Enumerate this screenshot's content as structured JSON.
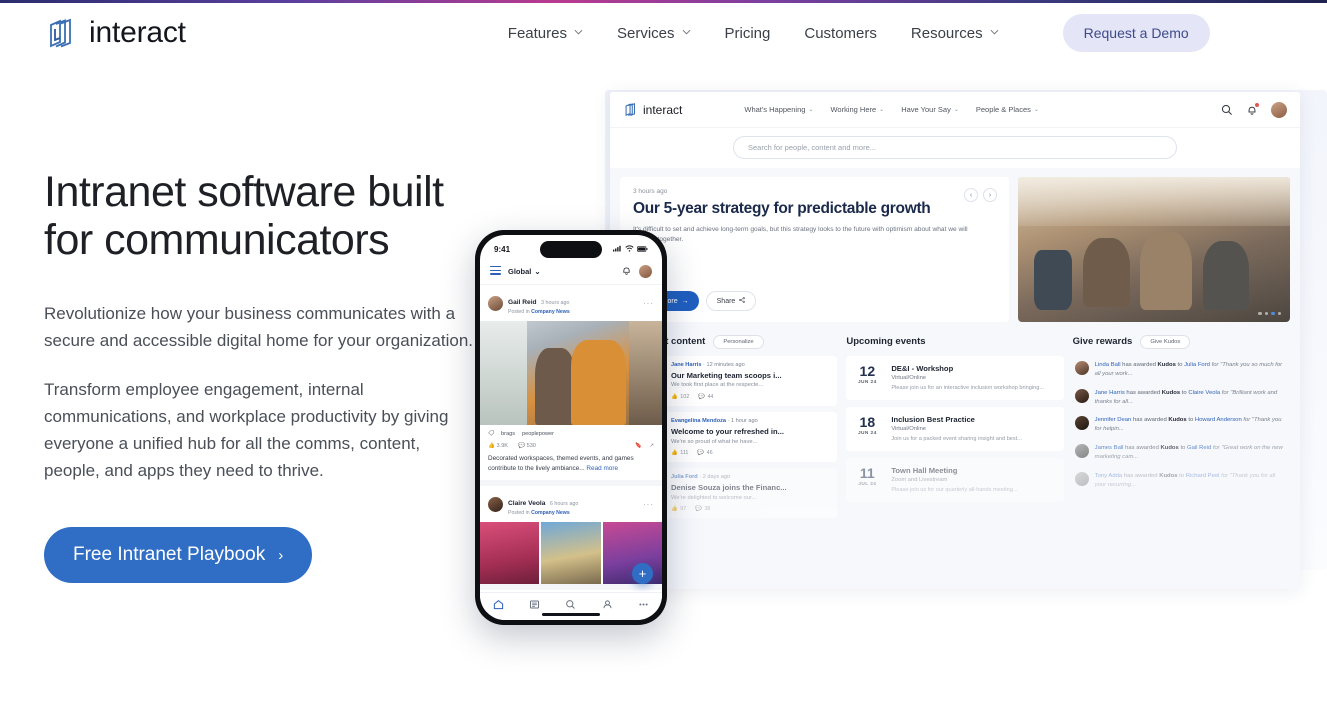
{
  "site": {
    "brand": "interact",
    "nav": [
      {
        "label": "Features",
        "caret": true
      },
      {
        "label": "Services",
        "caret": true
      },
      {
        "label": "Pricing",
        "caret": false
      },
      {
        "label": "Customers",
        "caret": false
      },
      {
        "label": "Resources",
        "caret": true
      }
    ],
    "demo_button": "Request a Demo",
    "accent_blue": "#2f6ec4",
    "demo_button_bg": "#e4e6f7"
  },
  "hero": {
    "title": "Intranet software built for communicators",
    "paragraph1": "Revolutionize how your business communicates with a secure and accessible digital home for your organization.",
    "paragraph2": "Transform employee engagement, internal communications, and workplace productivity by giving everyone a unified hub for all the comms, content, people, and apps they need to thrive.",
    "cta_label": "Free Intranet Playbook",
    "cta_chevron": "›"
  },
  "desktop_mock": {
    "brand": "interact",
    "nav": [
      {
        "label": "What's Happening",
        "caret": "⌄"
      },
      {
        "label": "Working Here",
        "caret": "⌄"
      },
      {
        "label": "Have Your Say",
        "caret": "⌄"
      },
      {
        "label": "People & Places",
        "caret": "⌄"
      }
    ],
    "search_placeholder": "Search for people, content and more...",
    "feature": {
      "timestamp": "3 hours ago",
      "title": "Our 5-year strategy for predictable growth",
      "description": "It's difficult to set and achieve long-term goals, but this strategy looks to the future with optimism about what we will achieve together.",
      "primary_button": "Read More",
      "primary_button_icon": "→",
      "secondary_button": "Share",
      "prev_icon": "‹",
      "next_icon": "›",
      "carousel_dots": 4,
      "carousel_active": 3
    },
    "columns": {
      "content": {
        "title": "Your latest content",
        "action": "Personalize",
        "items": [
          {
            "author": "Jane Harris",
            "time": "12 minutes ago",
            "title": "Our Marketing team scoops i...",
            "excerpt": "We took first place at the respecte...",
            "likes": "102",
            "comments": "44"
          },
          {
            "author": "Evangelina Mendoza",
            "time": "1 hour ago",
            "title": "Welcome to your refreshed in...",
            "excerpt": "We're so proud of what he have...",
            "likes": "111",
            "comments": "46"
          },
          {
            "author": "Julia Ford",
            "time": "2 days ago",
            "title": "Denise Souza joins the Financ...",
            "excerpt": "We're delighted to welcome our...",
            "likes": "97",
            "comments": "38"
          }
        ]
      },
      "events": {
        "title": "Upcoming events",
        "items": [
          {
            "day": "12",
            "month": "JUN 24",
            "title": "DE&I - Workshop",
            "location": "Virtual/Online",
            "description": "Please join us for an interactive inclusion workshop bringing..."
          },
          {
            "day": "18",
            "month": "JUN 24",
            "title": "Inclusion Best Practice",
            "location": "Virtual/Online",
            "description": "Join us for a packed event sharing insight and best..."
          },
          {
            "day": "11",
            "month": "JUL 24",
            "title": "Town Hall Meeting",
            "location": "Zoom and Livestream",
            "description": "Please join us for our quarterly all-hands meeting..."
          }
        ]
      },
      "rewards": {
        "title": "Give rewards",
        "action": "Give Kudos",
        "items": [
          {
            "giver": "Linda Ball",
            "verb": "has awarded",
            "badge": "Kudos",
            "to": "to",
            "receiver": "Julia Ford",
            "quote": "for \"Thank you so much for all your work..."
          },
          {
            "giver": "Jane Harris",
            "verb": "has awarded",
            "badge": "Kudos",
            "to": "to",
            "receiver": "Claire Veola",
            "quote": "for \"Brilliant work and thanks for all..."
          },
          {
            "giver": "Jennifer Dean",
            "verb": "has awarded",
            "badge": "Kudos",
            "to": "to",
            "receiver": "Howard Anderson",
            "quote": "for \"Thank you for helpin..."
          },
          {
            "giver": "James Ball",
            "verb": "has awarded",
            "badge": "Kudos",
            "to": "to",
            "receiver": "Gail Reid",
            "quote": "for \"Great work on the new marketing cam..."
          },
          {
            "giver": "Tony Adda",
            "verb": "has awarded",
            "badge": "Kudos",
            "to": "to",
            "receiver": "Richard Peel",
            "quote": "for \"Thank you for all your recurring..."
          }
        ]
      }
    }
  },
  "phone_mock": {
    "status_time": "9:41",
    "workspace": "Global",
    "workspace_caret": "⌄",
    "posts": [
      {
        "author": "Gail Reid",
        "time": "3 hours ago",
        "posted_in_prefix": "Posted in",
        "posted_in": "Company News",
        "tags": [
          "brags",
          "peoplepower"
        ],
        "likes": "3.9K",
        "comments": "530",
        "caption": "Decorated workspaces, themed events, and games contribute to the lively ambiance...",
        "read_more": "Read more"
      },
      {
        "author": "Claire Veola",
        "time": "6 hours ago",
        "posted_in_prefix": "Posted in",
        "posted_in": "Company News"
      }
    ],
    "fab_icon": "+"
  }
}
